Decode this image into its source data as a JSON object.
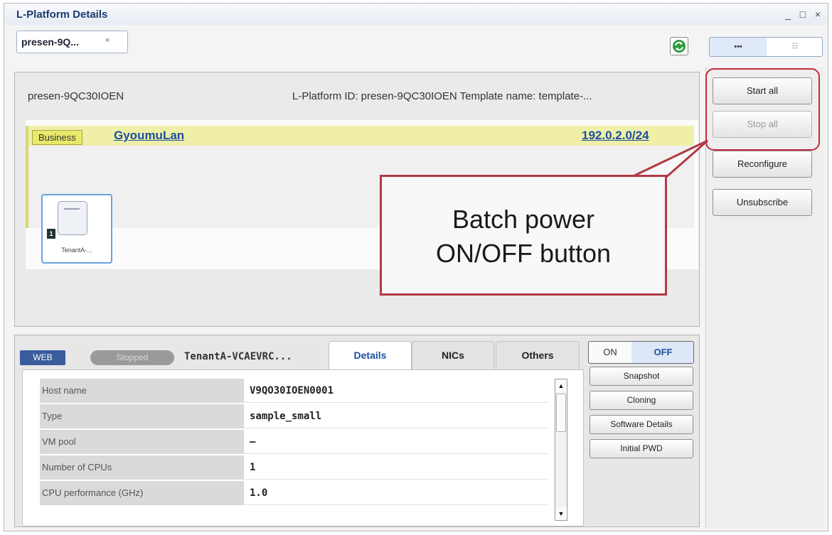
{
  "window": {
    "title": "L-Platform Details",
    "minimize": "_",
    "maximize": "□",
    "close": "×"
  },
  "tab": {
    "label": "presen-9Q...",
    "close": "×"
  },
  "view_toggle": {
    "left": "•••",
    "right": "☷"
  },
  "platform": {
    "name": "presen-9QC30IOEN",
    "meta": "L-Platform ID: presen-9QC30IOEN  Template name: template-..."
  },
  "network": {
    "type": "Business",
    "name": "GyoumuLan",
    "cidr": "192.0.2.0/24"
  },
  "server": {
    "number": "1",
    "name": "TenantA-..."
  },
  "side_buttons": {
    "start_all": "Start all",
    "stop_all": "Stop all",
    "reconfigure": "Reconfigure",
    "unsubscribe": "Unsubscribe"
  },
  "callout": {
    "line1": "Batch power",
    "line2": "ON/OFF button"
  },
  "vm": {
    "role": "WEB",
    "status": "Stopped",
    "name": "TenantA-VCAEVRC..."
  },
  "detail_tabs": [
    "Details",
    "NICs",
    "Others"
  ],
  "properties": [
    {
      "label": "Host name",
      "value": "V9QO30IOEN0001"
    },
    {
      "label": "Type",
      "value": "sample_small"
    },
    {
      "label": "VM pool",
      "value": "–"
    },
    {
      "label": "Number of CPUs",
      "value": "1"
    },
    {
      "label": "CPU performance (GHz)",
      "value": "1.0"
    }
  ],
  "power": {
    "on": "ON",
    "off": "OFF"
  },
  "vm_buttons": {
    "snapshot": "Snapshot",
    "cloning": "Cloning",
    "software_details": "Software Details",
    "initial_pwd": "Initial PWD"
  },
  "colors": {
    "accent": "#1c4fa0",
    "highlight": "#c8283a",
    "network_bar": "#efefa8"
  }
}
